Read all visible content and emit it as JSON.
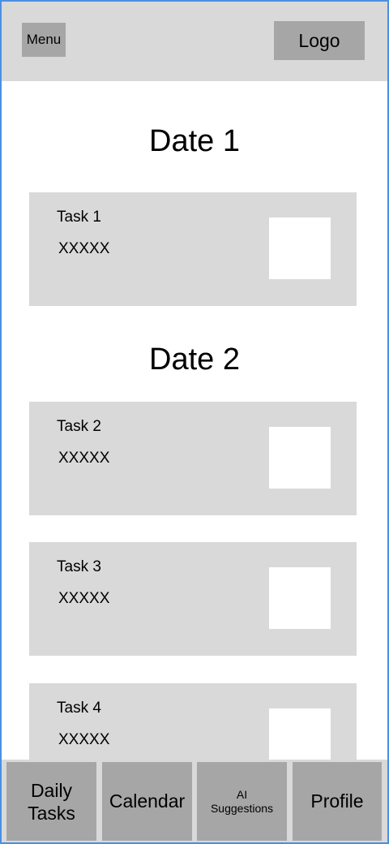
{
  "header": {
    "menu_label": "Menu",
    "logo_label": "Logo"
  },
  "sections": [
    {
      "date": "Date 1",
      "tasks": [
        {
          "title": "Task 1",
          "description": "XXXXX"
        }
      ]
    },
    {
      "date": "Date 2",
      "tasks": [
        {
          "title": "Task 2",
          "description": "XXXXX"
        },
        {
          "title": "Task 3",
          "description": "XXXXX"
        },
        {
          "title": "Task 4",
          "description": "XXXXX"
        }
      ]
    }
  ],
  "bottom_nav": {
    "items": [
      {
        "label": "Daily Tasks"
      },
      {
        "label": "Calendar"
      },
      {
        "label": "AI Suggestions"
      },
      {
        "label": "Profile"
      }
    ]
  }
}
